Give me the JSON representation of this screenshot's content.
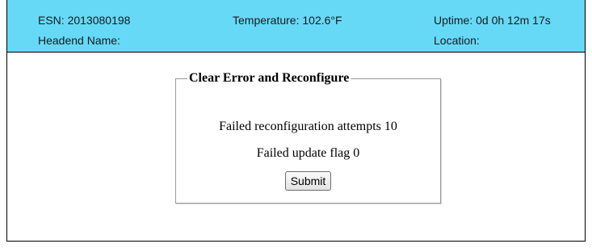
{
  "header": {
    "esn": "ESN: 2013080198",
    "temperature": "Temperature: 102.6°F",
    "uptime": "Uptime: 0d 0h 12m 17s",
    "headend_name": "Headend Name:",
    "location": "Location:"
  },
  "reconfig_form": {
    "legend": "Clear Error and Reconfigure",
    "failed_attempts": "Failed reconfiguration attempts 10",
    "failed_update_flag": "Failed update flag 0",
    "submit_label": "Submit"
  },
  "colors": {
    "header_background": "#66d9f7"
  }
}
